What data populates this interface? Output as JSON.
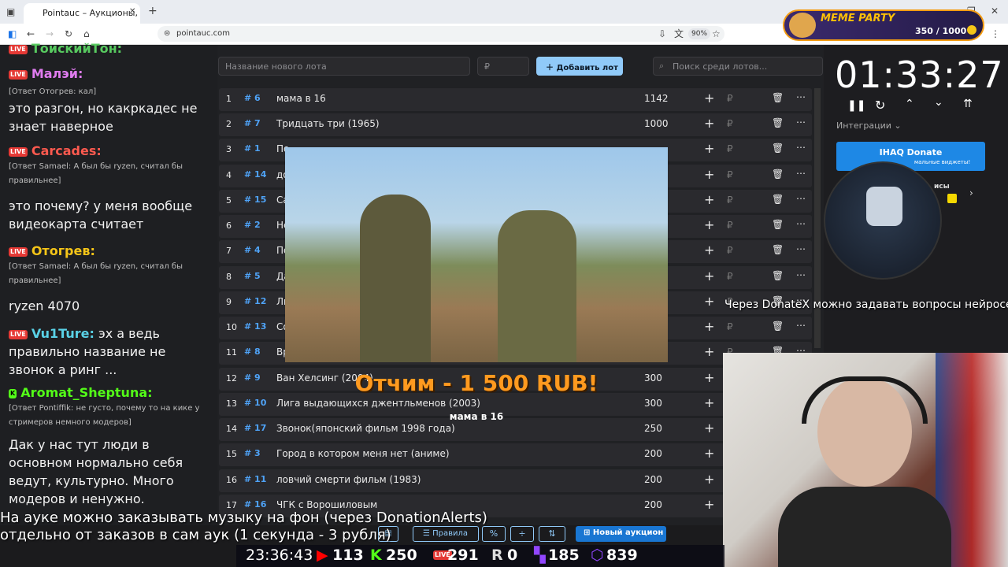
{
  "browser": {
    "tab_title": "Pointauc – Аукционы, лотереи",
    "url": "pointauc.com",
    "zoom": "90%"
  },
  "meme_party": {
    "label": "MEME PARTY",
    "progress": "350 / 1000"
  },
  "chat": {
    "messages": [
      {
        "nick": "ТоискийТон:",
        "text": ""
      },
      {
        "nick": "Малэй:",
        "text": ""
      },
      {
        "reply": "[Ответ Отогрев: кал]",
        "text": "это разгон, но какркадес не знает наверное"
      },
      {
        "nick": "Carcades:",
        "reply": "[Ответ Samael: А был бы ryzen, считал бы правильнее]"
      },
      {
        "text": "это почему? у меня вообще видеокарта считает"
      },
      {
        "nick": "Отогрев:",
        "reply": "[Ответ Samael: А был бы ryzen, считал бы правильнее]"
      },
      {
        "text": "ryzen 4070"
      },
      {
        "nick": "Vu1Ture:",
        "text": "эх а ведь правильно название не звонок а ринг ..."
      },
      {
        "nick": "Aromat_Sheptuna:",
        "reply": "[Ответ Pontiffik: не густо, почему то на кике у стримеров немного модеров]"
      },
      {
        "text": "Дак у нас тут люди в основном нормально себя ведут, культурно. Много модеров и ненужно."
      }
    ]
  },
  "auction": {
    "new_lot_placeholder": "Название нового лота",
    "amount_placeholder": "₽",
    "add_lot_label": "Добавить лот",
    "search_placeholder": "Поиск среди лотов...",
    "lots": [
      {
        "n": "1",
        "id": "# 6",
        "name": "мама в 16",
        "amount": "1142"
      },
      {
        "n": "2",
        "id": "# 7",
        "name": "Тридцать три (1965)",
        "amount": "1000"
      },
      {
        "n": "3",
        "id": "# 1",
        "name": "По",
        "amount": ""
      },
      {
        "n": "4",
        "id": "# 14",
        "name": "до",
        "amount": ""
      },
      {
        "n": "5",
        "id": "# 15",
        "name": "Са",
        "amount": ""
      },
      {
        "n": "6",
        "id": "# 2",
        "name": "Не",
        "amount": ""
      },
      {
        "n": "7",
        "id": "# 4",
        "name": "По",
        "amount": ""
      },
      {
        "n": "8",
        "id": "# 5",
        "name": "Да",
        "amount": ""
      },
      {
        "n": "9",
        "id": "# 12",
        "name": "Ли",
        "amount": ""
      },
      {
        "n": "10",
        "id": "# 13",
        "name": "Со",
        "amount": ""
      },
      {
        "n": "11",
        "id": "# 8",
        "name": "Вр",
        "amount": ""
      },
      {
        "n": "12",
        "id": "# 9",
        "name": "Ван Хелсинг (2004)",
        "amount": "300"
      },
      {
        "n": "13",
        "id": "# 10",
        "name": "Лига выдающихся джентльменов (2003)",
        "amount": "300"
      },
      {
        "n": "14",
        "id": "# 17",
        "name": "Звонок(японский фильм 1998 года)",
        "amount": "250"
      },
      {
        "n": "15",
        "id": "# 3",
        "name": "Город в котором меня нет (аниме)",
        "amount": "200"
      },
      {
        "n": "16",
        "id": "# 11",
        "name": "ловчий смерти фильм (1983)",
        "amount": "200"
      },
      {
        "n": "17",
        "id": "# 16",
        "name": "ЧГК с Ворошиловым",
        "amount": "200"
      }
    ],
    "bottom_buttons": {
      "rules": "Правила",
      "new_auction": "Новый аукцион"
    }
  },
  "alert": {
    "title": "Отчим - 1 500 RUB!",
    "message": "мама в 16"
  },
  "right_panel": {
    "timer": "01:33:27",
    "integrations_label": "Интеграции",
    "donate_label": "IHAQ Donate",
    "donate_sub": "мальные виджеты!",
    "side_text": "исы"
  },
  "overlay": {
    "donatex_text": "Через DonateX можно задавать вопросы нейросети",
    "subtitle_line1": "На ауке можно заказывать музыку на фон (через DonationAlerts)",
    "subtitle_line2": "отдельно от заказов в сам аук (1 секунда - 3 рубля)"
  },
  "stats": {
    "clock": "23:36:43",
    "youtube": "113",
    "kick": "250",
    "vk_live": "291",
    "rutube": "0",
    "twitch": "185",
    "total": "839"
  }
}
